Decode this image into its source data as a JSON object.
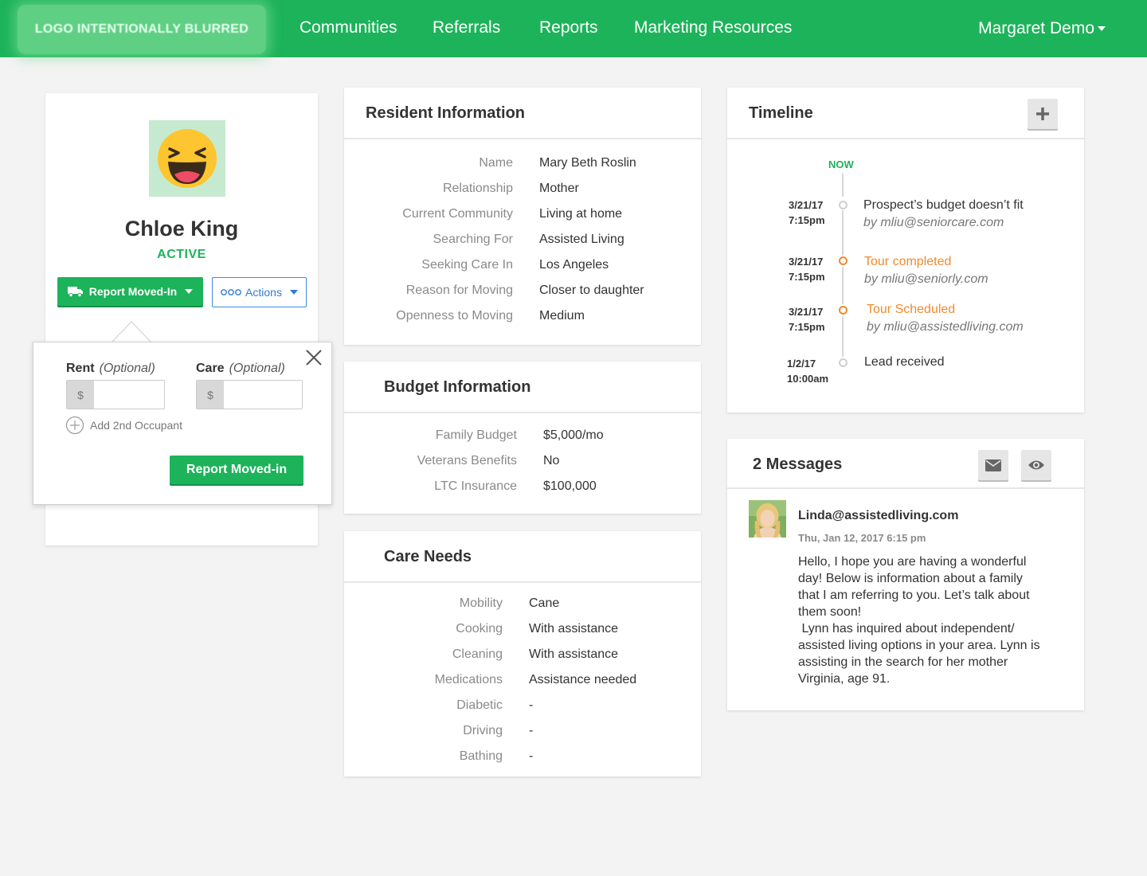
{
  "nav": {
    "logo_text": "LOGO INTENTIONALLY BLURRED",
    "items": [
      "Communities",
      "Referrals",
      "Reports",
      "Marketing Resources"
    ],
    "user": "Margaret Demo"
  },
  "profile": {
    "name": "Chloe King",
    "status": "ACTIVE",
    "report_button": "Report Moved-In",
    "actions_button": "Actions"
  },
  "popup": {
    "rent_label": "Rent",
    "care_label": "Care",
    "optional": "(Optional)",
    "currency": "$",
    "rent_value": "",
    "care_value": "",
    "add_occupant": "Add 2nd Occupant",
    "submit": "Report Moved-in"
  },
  "resident": {
    "title": "Resident Information",
    "rows": [
      {
        "label": "Name",
        "value": "Mary Beth Roslin"
      },
      {
        "label": "Relationship",
        "value": "Mother"
      },
      {
        "label": "Current Community",
        "value": "Living at home"
      },
      {
        "label": "Searching For",
        "value": "Assisted Living"
      },
      {
        "label": "Seeking Care In",
        "value": "Los Angeles"
      },
      {
        "label": "Reason for Moving",
        "value": "Closer to daughter"
      },
      {
        "label": "Openness to Moving",
        "value": "Medium"
      }
    ]
  },
  "budget": {
    "title": "Budget Information",
    "rows": [
      {
        "label": "Family Budget",
        "value": "$5,000/mo"
      },
      {
        "label": "Veterans Benefits",
        "value": "No"
      },
      {
        "label": "LTC Insurance",
        "value": "$100,000"
      }
    ]
  },
  "care": {
    "title": "Care Needs",
    "rows": [
      {
        "label": "Mobility",
        "value": "Cane"
      },
      {
        "label": "Cooking",
        "value": "With assistance"
      },
      {
        "label": "Cleaning",
        "value": "With assistance"
      },
      {
        "label": "Medications",
        "value": "Assistance needed"
      },
      {
        "label": "Diabetic",
        "value": "-"
      },
      {
        "label": "Driving",
        "value": "-"
      },
      {
        "label": "Bathing",
        "value": "-"
      }
    ]
  },
  "timeline": {
    "title": "Timeline",
    "now": "NOW",
    "events": [
      {
        "date": "3/21/17",
        "time": "7:15pm",
        "title": "Prospect’s budget doesn’t fit",
        "by": "by mliu@seniorcare.com",
        "color": "#cfcfcf"
      },
      {
        "date": "3/21/17",
        "time": "7:15pm",
        "title": "Tour completed",
        "by": "by mliu@seniorly.com",
        "color": "#f08a2c"
      },
      {
        "date": "3/21/17",
        "time": "7:15pm",
        "title": "Tour Scheduled",
        "by": "by mliu@assistedliving.com",
        "color": "#f08a2c"
      },
      {
        "date": "1/2/17",
        "time": "10:00am",
        "title": "Lead received",
        "by": "",
        "color": "#cfcfcf"
      }
    ]
  },
  "messages": {
    "title": "2 Messages",
    "sender": "Linda@assistedliving.com",
    "timestamp": "Thu, Jan 12, 2017 6:15 pm",
    "body_lines": [
      "Hello, I hope you are having a wonderful",
      "day! Below is information about a family",
      "that I am referring to you. Let’s talk about",
      "them soon!",
      " Lynn has inquired about independent/",
      "assisted living options in your area. Lynn is",
      "assisting in the search for her mother",
      "Virginia, age 91."
    ]
  },
  "colors": {
    "brand_green": "#1db35a",
    "accent_orange": "#f08a2c",
    "link_blue": "#2f7bd3"
  }
}
